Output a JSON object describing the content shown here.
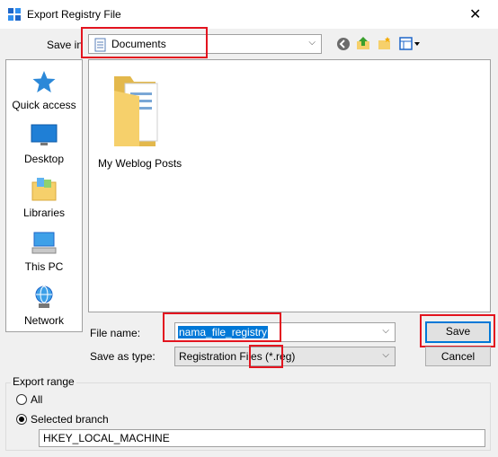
{
  "window": {
    "title": "Export Registry File",
    "close_glyph": "✕"
  },
  "save_in": {
    "label": "Save in",
    "value": "Documents"
  },
  "toolbar": {
    "icons": [
      "back-icon",
      "up-folder-icon",
      "new-folder-icon",
      "view-menu-icon"
    ]
  },
  "places": [
    {
      "label": "Quick access",
      "icon": "quick-access-icon"
    },
    {
      "label": "Desktop",
      "icon": "desktop-icon"
    },
    {
      "label": "Libraries",
      "icon": "libraries-icon"
    },
    {
      "label": "This PC",
      "icon": "this-pc-icon"
    },
    {
      "label": "Network",
      "icon": "network-icon"
    }
  ],
  "files": [
    {
      "name": "My Weblog Posts",
      "icon": "folder-icon"
    }
  ],
  "file_name": {
    "label": "File name:",
    "value": "nama_file_registry"
  },
  "save_as_type": {
    "label": "Save as type:",
    "value": "Registration Files (*.reg)"
  },
  "buttons": {
    "save": "Save",
    "cancel": "Cancel"
  },
  "export_range": {
    "title": "Export range",
    "options": [
      {
        "label": "All",
        "selected": false
      },
      {
        "label": "Selected branch",
        "selected": true
      }
    ],
    "branch_value": "HKEY_LOCAL_MACHINE"
  },
  "colors": {
    "highlight_red": "#e3141f",
    "selection_blue": "#0078d7",
    "folder_yellow": "#f6d06b"
  }
}
